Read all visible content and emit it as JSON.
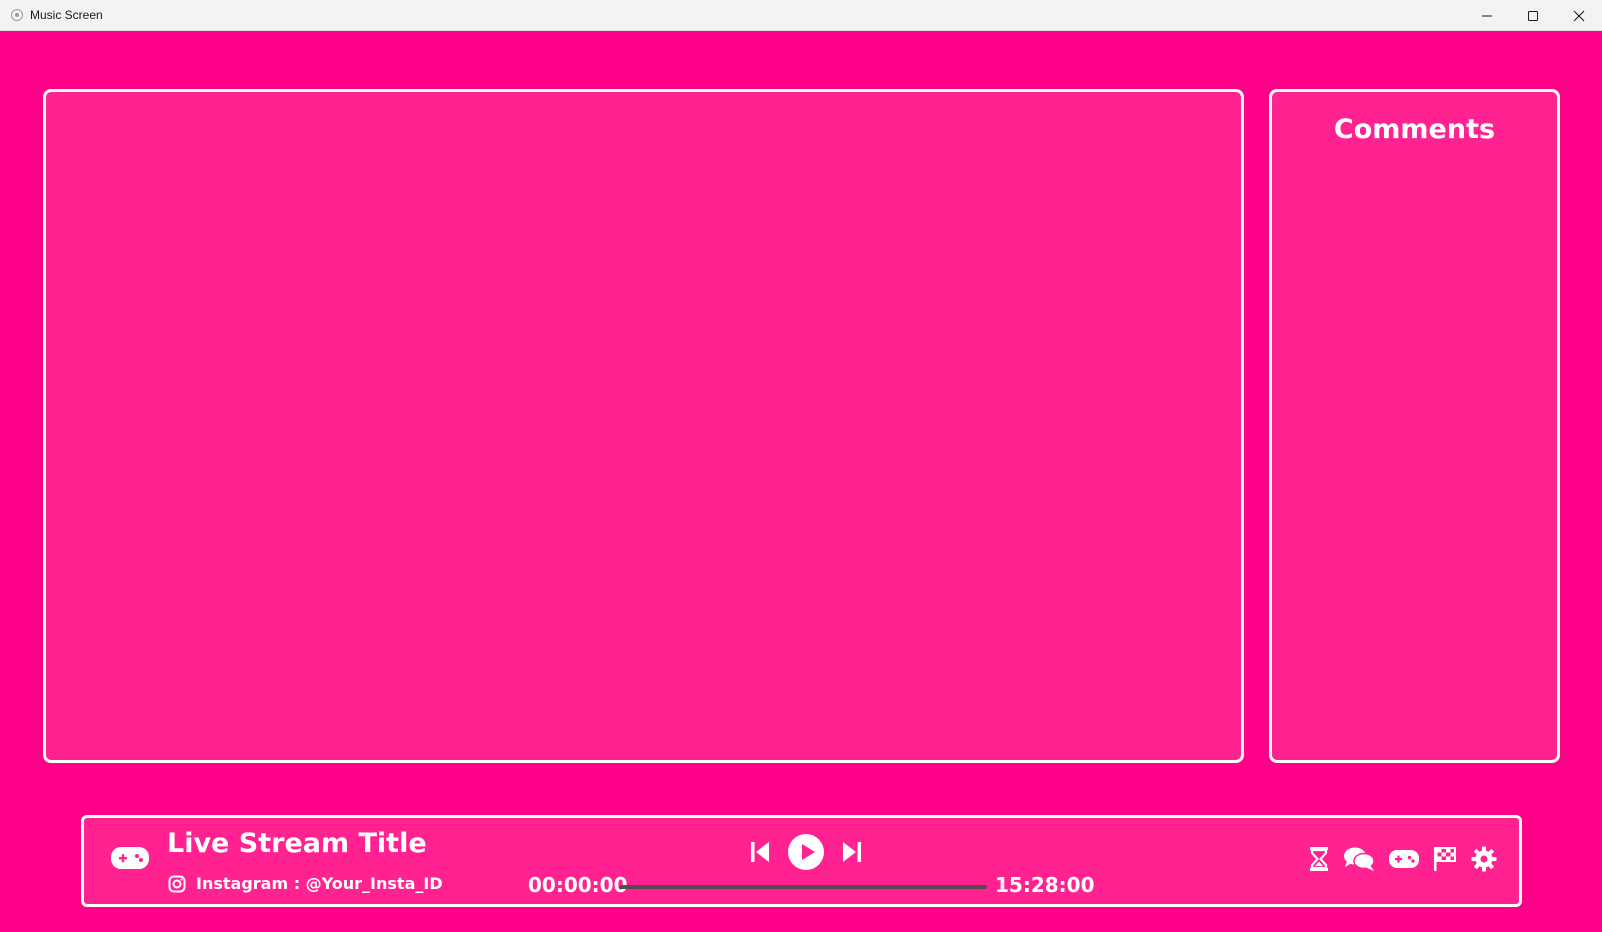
{
  "window": {
    "title": "Music Screen",
    "controls": [
      "minimize-icon",
      "maximize-icon",
      "close-icon"
    ]
  },
  "colors": {
    "background": "#ff0088",
    "panel": "#ff2290",
    "border": "#ffffff",
    "track": "#5a4a54"
  },
  "comments": {
    "title": "Comments"
  },
  "player": {
    "title": "Live Stream Title",
    "instagram_label": "Instagram : @Your_Insta_ID",
    "time_current": "00:00:00",
    "time_total": "15:28:00",
    "progress_fraction": 0.0,
    "icons": [
      "gamepad-icon",
      "instagram-icon",
      "previous-icon",
      "play-icon",
      "next-icon",
      "hourglass-icon",
      "chat-icon",
      "gamepad-icon",
      "checkered-flag-icon",
      "gear-icon"
    ]
  }
}
